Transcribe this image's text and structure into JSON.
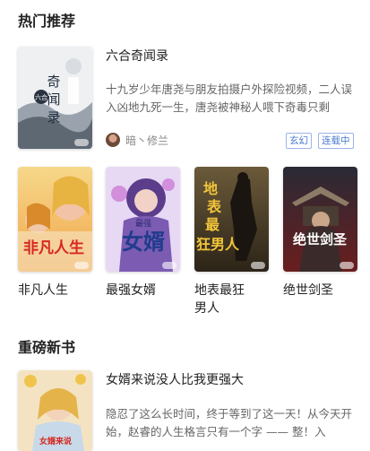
{
  "hot_section": {
    "title": "热门推荐",
    "featured": {
      "cover_title": "奇闻录",
      "cover_subtitle": "六合",
      "title": "六合奇闻录",
      "description": "十九岁少年唐尧与朋友拍摄户外探险视频，二人误入凶地九死一生，唐尧被神秘人喂下奇毒只剩",
      "author": "暗丶修兰",
      "tags": [
        "玄幻",
        "连载中"
      ]
    },
    "books": [
      {
        "label": "非凡人生",
        "cover_text": "非凡人生"
      },
      {
        "label": "最强女婿",
        "cover_text": "女婿",
        "cover_small": "最强"
      },
      {
        "label": "地表最狂男人",
        "cover_text": "地表最狂男人"
      },
      {
        "label": "绝世剑圣",
        "cover_text": "绝世剑圣"
      }
    ]
  },
  "new_section": {
    "title": "重磅新书",
    "book": {
      "title": "女婿来说没人比我更强大",
      "description": "隐忍了这么长时间，终于等到了这一天！从今天开始，赵睿的人生格言只有一个字 —— 整！入"
    }
  },
  "colors": {
    "tag_text": "#4a7ad1",
    "tag_border": "#9bb5e6"
  }
}
